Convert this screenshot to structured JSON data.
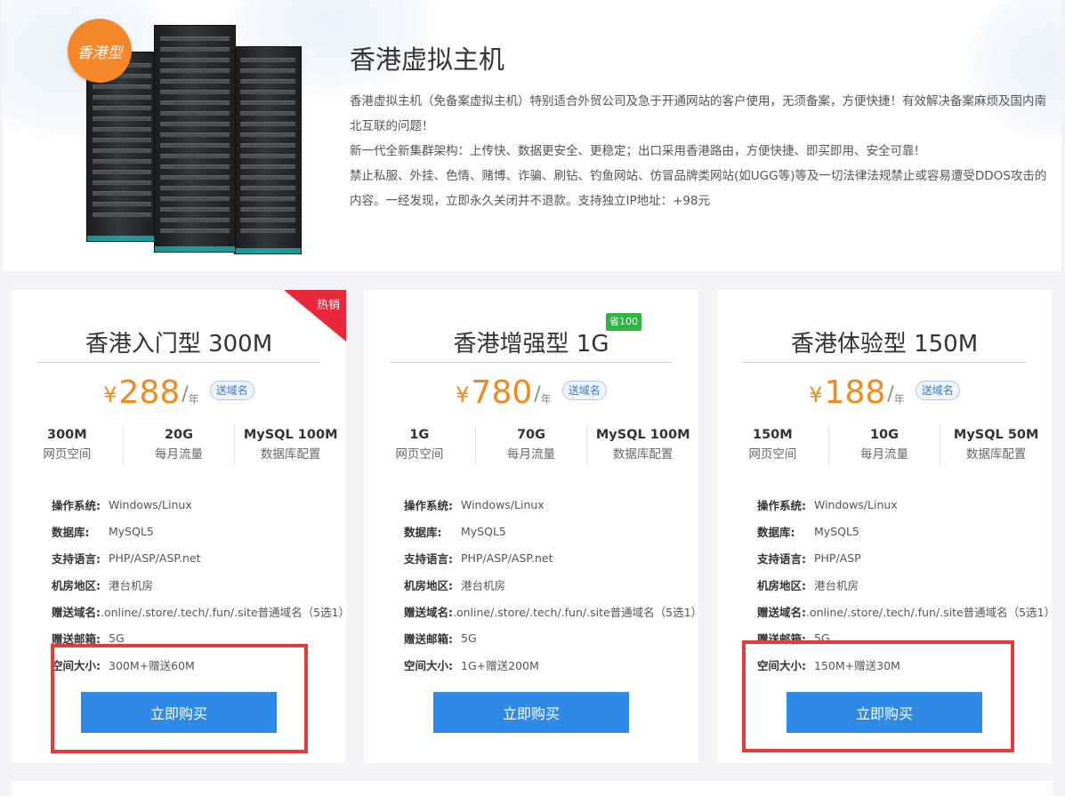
{
  "intro": {
    "badge": "香港型",
    "title": "香港虚拟主机",
    "desc": [
      "香港虚拟主机（免备案虚拟主机）特别适合外贸公司及急于开通网站的客户使用，无须备案，方便快捷！有效解决备案麻烦及国内南北互联的问题！",
      "新一代全新集群架构：上传快、数据更安全、更稳定；出口采用香港路由，方便快捷、即买即用、安全可靠!",
      "禁止私服、外挂、色情、赌博、诈骗、刷钻、钓鱼网站、仿冒品牌类网站(如UGG等)等及一切法律法规禁止或容易遭受DDOS攻击的内容。一经发现，立即永久关闭并不退款。支持独立IP地址：+98元"
    ]
  },
  "cards": [
    {
      "title": "香港入门型 300M",
      "corner_tag": "热销",
      "price_symbol": "¥",
      "price": "288",
      "price_slash": "/",
      "price_unit": "年",
      "gift": "送域名",
      "specs": [
        {
          "value": "300M",
          "label": "网页空间"
        },
        {
          "value": "20G",
          "label": "每月流量"
        },
        {
          "value": "MySQL 100M",
          "label": "数据库配置"
        }
      ],
      "details": [
        {
          "key": "操作系统:",
          "value": "Windows/Linux"
        },
        {
          "key": "数据库:",
          "value": "MySQL5"
        },
        {
          "key": "支持语言:",
          "value": "PHP/ASP/ASP.net"
        },
        {
          "key": "机房地区:",
          "value": "港台机房"
        },
        {
          "key": "赠送域名:",
          "value": ".online/.store/.tech/.fun/.site普通域名（5选1）"
        },
        {
          "key": "赠送邮箱:",
          "value": "5G"
        },
        {
          "key": "空间大小:",
          "value": "300M+赠送60M"
        }
      ],
      "buy_label": "立即购买"
    },
    {
      "title": "香港增强型 1G",
      "save_tag": "省100",
      "price_symbol": "¥",
      "price": "780",
      "price_slash": "/",
      "price_unit": "年",
      "gift": "送域名",
      "specs": [
        {
          "value": "1G",
          "label": "网页空间"
        },
        {
          "value": "70G",
          "label": "每月流量"
        },
        {
          "value": "MySQL 100M",
          "label": "数据库配置"
        }
      ],
      "details": [
        {
          "key": "操作系统:",
          "value": "Windows/Linux"
        },
        {
          "key": "数据库:",
          "value": "MySQL5"
        },
        {
          "key": "支持语言:",
          "value": "PHP/ASP/ASP.net"
        },
        {
          "key": "机房地区:",
          "value": "港台机房"
        },
        {
          "key": "赠送域名:",
          "value": ".online/.store/.tech/.fun/.site普通域名（5选1）"
        },
        {
          "key": "赠送邮箱:",
          "value": "5G"
        },
        {
          "key": "空间大小:",
          "value": "1G+赠送200M"
        }
      ],
      "buy_label": "立即购买"
    },
    {
      "title": "香港体验型 150M",
      "price_symbol": "¥",
      "price": "188",
      "price_slash": "/",
      "price_unit": "年",
      "gift": "送域名",
      "specs": [
        {
          "value": "150M",
          "label": "网页空间"
        },
        {
          "value": "10G",
          "label": "每月流量"
        },
        {
          "value": "MySQL 50M",
          "label": "数据库配置"
        }
      ],
      "details": [
        {
          "key": "操作系统:",
          "value": "Windows/Linux"
        },
        {
          "key": "数据库:",
          "value": "MySQL5"
        },
        {
          "key": "支持语言:",
          "value": "PHP/ASP"
        },
        {
          "key": "机房地区:",
          "value": "港台机房"
        },
        {
          "key": "赠送域名:",
          "value": ".online/.store/.tech/.fun/.site普通域名（5选1）"
        },
        {
          "key": "赠送邮箱:",
          "value": "5G"
        },
        {
          "key": "空间大小:",
          "value": "150M+赠送30M"
        }
      ],
      "buy_label": "立即购买"
    }
  ],
  "colors": {
    "accent_orange": "#f08a1c",
    "button_blue": "#2f8ae6",
    "hot_red": "#e8283a",
    "save_green": "#2fb543",
    "annotation_red": "#e53b3b"
  }
}
